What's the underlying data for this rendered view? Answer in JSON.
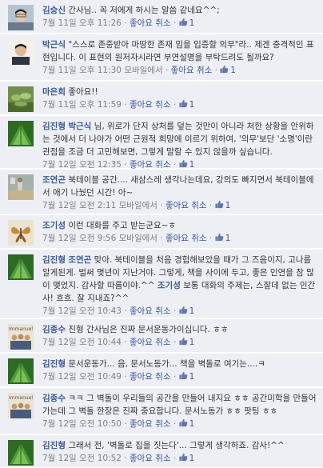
{
  "comments": [
    {
      "author": "김승신",
      "mention": "",
      "text": "간사님.. 꼭 저에게 하시는 말씀 같네요^^;",
      "mention2": "",
      "text2": "",
      "timestamp": "7월 11일 오후 11:26",
      "via": "",
      "like_label": "좋아요 취소",
      "like_count": "1",
      "avatar": "person-photo-icon"
    },
    {
      "author": "박근식",
      "mention": "",
      "text": "\"스스로 존중받아 마땅한 존재 임을 입증할 의무\"라.. 제겐 충격적인 표현입니다. 이 표현의 원저자시라면 부연설명을 부탁드려도 될까요?",
      "mention2": "",
      "text2": "",
      "timestamp": "7월 11일 오후 11:30",
      "via": "모바일에서",
      "like_label": "좋아요 취소",
      "like_count": "1",
      "avatar": "person-photo-icon"
    },
    {
      "author": "마은희",
      "mention": "",
      "text": "좋아요!!",
      "mention2": "",
      "text2": "",
      "timestamp": "7월 11일 오후 11:59",
      "via": "",
      "like_label": "좋아요 취소",
      "like_count": "1",
      "avatar": "plant-photo-icon"
    },
    {
      "author": "김진형",
      "mention": "박근식",
      "text": "님, 위로가 단지 상처를 덮는 것만이 아니라 처한 상황을 안위하는 것에서 더 나아가 어떤 근원적 희망에 이르기 위하여, '의무'보단 '소명'이란 관점을 조금 더 고민해보면, 그렇게 말할 수 있지 않을까 싶습니다.",
      "mention2": "",
      "text2": "",
      "timestamp": "7월 12일 오전 12:35",
      "via": "",
      "like_label": "좋아요 취소",
      "like_count": "1",
      "avatar": "leaf-photo-icon"
    },
    {
      "author": "조연곤",
      "mention": "",
      "text": "북테이블 공간.... 새삼스레 생각나는데요, 강의도 빠지면서 북테이블에서 애기 나눴던 시간! 아~",
      "mention2": "",
      "text2": "",
      "timestamp": "7월 12일 오전 2:11",
      "via": "모바일에서",
      "like_label": "좋아요 취소",
      "like_count": "1",
      "avatar": "room-photo-icon"
    },
    {
      "author": "조기성",
      "mention": "",
      "text": "이런 대화를 주고 받는군요~ㅎ",
      "mention2": "",
      "text2": "",
      "timestamp": "7월 12일 오전 9:56",
      "via": "모바일에서",
      "like_label": "좋아요 취소",
      "like_count": "1",
      "avatar": "butterfly-photo-icon"
    },
    {
      "author": "김진형",
      "mention": "조연곤",
      "text": "맞아. 북테이블을 처음 경험해보았을 때가 그 즈음이지, 고나를 알게된게. 벌써 몇년이 지난거야. 그렇게, 책을 사이에 두고, 좋은 인연을 참 많이 맺었지. 감사할 따름이야.^^",
      "mention2": "조기성",
      "text2": "보통 대화의 주제는, 스잘데 없는 인간사! 흐흐. 잘 지내죠?^^",
      "timestamp": "7월 12일 오전 10:43",
      "via": "",
      "like_label": "좋아요 취소",
      "like_count": "1",
      "avatar": "leaf-photo-icon"
    },
    {
      "author": "김종수",
      "mention": "",
      "text": "진형 간사님은 진짜 문서운동가이십니다. ㅎㅎ",
      "mention2": "",
      "text2": "",
      "timestamp": "7월 12일 오전 10:44",
      "via": "",
      "like_label": "좋아요 취소",
      "like_count": "1",
      "avatar": "group-photo-icon"
    },
    {
      "author": "김진형",
      "mention": "",
      "text": "문서운동가... 음, 문서노동가... 책을 벽돌로 여기는....ㅋ",
      "mention2": "",
      "text2": "",
      "timestamp": "7월 12일 오전 10:49",
      "via": "",
      "like_label": "좋아요 취소",
      "like_count": "1",
      "avatar": "leaf-photo-icon"
    },
    {
      "author": "김종수",
      "mention": "",
      "text": "ㅋㅋ 그 벽돌이 우리들의 공간을 만들어 내지요 ㅎㅎ 공간미학을 만들어 가는데 그 벽돌 한장은 진짜 중요합니다. 문서노동가 ㅎㅎ 팟팅 ㅎㅎ",
      "mention2": "",
      "text2": "",
      "timestamp": "7월 12일 오전 10:50",
      "via": "",
      "like_label": "좋아요 취소",
      "like_count": "1",
      "avatar": "group-photo-icon"
    },
    {
      "author": "김진형",
      "mention": "",
      "text": "그래서 전, '벽돌로 집을 짓는다'... 그렇게 생각하죠. 감사!^^",
      "mention2": "",
      "text2": "",
      "timestamp": "7월 12일 오전 10:52",
      "via": "",
      "like_label": "좋아요 취소",
      "like_count": "1",
      "avatar": "leaf-photo-icon"
    }
  ],
  "group_photo_caption": "Immanuel",
  "colors": {
    "link": "#3b5998",
    "comment_bg": "#edeff4",
    "meta": "#808080"
  }
}
